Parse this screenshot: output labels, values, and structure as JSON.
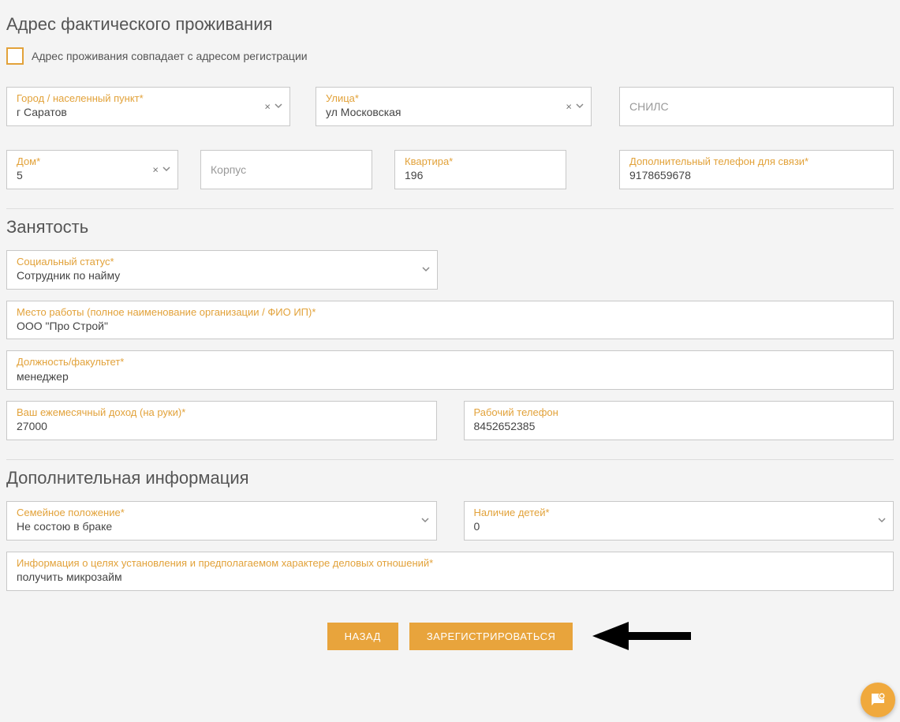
{
  "address": {
    "section_title": "Адрес фактического проживания",
    "match_checkbox_label": "Адрес проживания совпадает с адресом регистрации",
    "city": {
      "label": "Город / населенный пункт*",
      "value": "г Саратов"
    },
    "street": {
      "label": "Улица*",
      "value": "ул Московская"
    },
    "snils": {
      "placeholder": "СНИЛС",
      "value": ""
    },
    "house": {
      "label": "Дом*",
      "value": "5"
    },
    "corp": {
      "placeholder": "Корпус",
      "value": ""
    },
    "flat": {
      "label": "Квартира*",
      "value": "196"
    },
    "extra_phone": {
      "label": "Дополнительный телефон для связи*",
      "value": "9178659678"
    }
  },
  "employment": {
    "section_title": "Занятость",
    "status": {
      "label": "Социальный статус*",
      "value": "Сотрудник по найму"
    },
    "workplace": {
      "label": "Место работы (полное наименование организации / ФИО ИП)*",
      "value": "ООО \"Про Строй\""
    },
    "position": {
      "label": "Должность/факультет*",
      "value": "менеджер"
    },
    "income": {
      "label": "Ваш ежемесячный доход (на руки)*",
      "value": "27000"
    },
    "work_phone": {
      "label": "Рабочий телефон",
      "value": "8452652385"
    }
  },
  "extra": {
    "section_title": "Дополнительная информация",
    "marital": {
      "label": "Семейное положение*",
      "value": "Не состою в браке"
    },
    "children": {
      "label": "Наличие детей*",
      "value": "0"
    },
    "purpose": {
      "label": "Информация о целях установления и предполагаемом характере деловых отношений*",
      "value": "получить микрозайм"
    }
  },
  "buttons": {
    "back": "НАЗАД",
    "register": "ЗАРЕГИСТРИРОВАТЬСЯ"
  }
}
